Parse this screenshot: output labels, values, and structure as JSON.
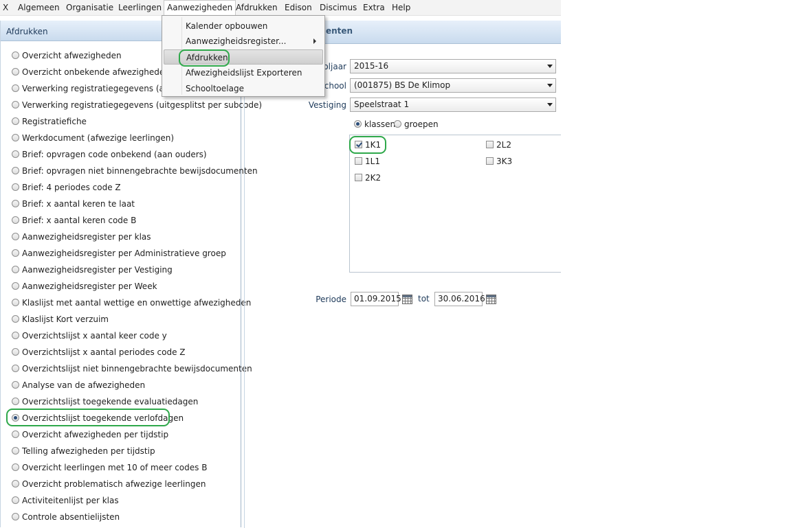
{
  "menubar": {
    "items": [
      "X",
      "Algemeen",
      "Organisatie",
      "Leerlingen",
      "Aanwezigheden",
      "Afdrukken",
      "Edison",
      "Discimus",
      "Extra",
      "Help"
    ]
  },
  "dropdown": {
    "items": [
      {
        "label": "Kalender opbouwen"
      },
      {
        "label": "Aanwezigheidsregister..."
      },
      {
        "label": "Afdrukken"
      },
      {
        "label": "Afwezigheidslijst Exporteren"
      },
      {
        "label": "Schooltoelage"
      }
    ]
  },
  "left_panel": {
    "title": "Afdrukken",
    "options": [
      "Overzicht afwezigheden",
      "Overzicht onbekende afwezigheden",
      "Verwerking registratiegegevens (alle codes)",
      "Verwerking registratiegegevens (uitgesplitst per subcode)",
      "Registratiefiche",
      "Werkdocument (afwezige leerlingen)",
      "Brief: opvragen code onbekend (aan ouders)",
      "Brief: opvragen niet binnengebrachte bewijsdocumenten",
      "Brief: 4 periodes code Z",
      "Brief: x aantal keren te laat",
      "Brief: x aantal keren code B",
      "Aanwezigheidsregister per klas",
      "Aanwezigheidsregister per Administratieve groep",
      "Aanwezigheidsregister per Vestiging",
      "Aanwezigheidsregister per Week",
      "Klaslijst met aantal wettige en onwettige afwezigheden",
      "Klaslijst Kort verzuim",
      "Overzichtslijst x aantal keer code y",
      "Overzichtslijst x aantal periodes code Z",
      "Overzichtslijst niet binnengebrachte bewijsdocumenten",
      "Analyse van de afwezigheden",
      "Overzichtslijst toegekende evaluatiedagen",
      "Overzichtslijst toegekende verlofdagen",
      "Overzicht afwezigheden per tijdstip",
      "Telling afwezigheden per tijdstip",
      "Overzicht leerlingen met 10 of meer codes B",
      "Overzicht problematisch afwezige leerlingen",
      "Activiteitenlijst per klas",
      "Controle absentielijsten"
    ],
    "selected": "Overzichtslijst toegekende verlofdagen"
  },
  "right_panel": {
    "header": "enten",
    "schooljaar_label": "oljaar",
    "schooljaar_value": "2015-16",
    "school_label": "chool",
    "school_value": "(001875) BS De Klimop",
    "vestiging_label": "Vestiging",
    "vestiging_value": "Speelstraat 1",
    "group_by": {
      "option1": "klassen",
      "option2": "groepen",
      "selected": "klassen"
    },
    "classes": [
      {
        "name": "1K1",
        "checked": true
      },
      {
        "name": "1L1",
        "checked": false
      },
      {
        "name": "2K2",
        "checked": false
      },
      {
        "name": "2L2",
        "checked": false
      },
      {
        "name": "3K3",
        "checked": false
      }
    ],
    "periode_label": "Periode",
    "periode_from": "01.09.2015",
    "tot_label": "tot",
    "periode_to": "30.06.2016"
  },
  "colors": {
    "highlight": "#2ea84a",
    "header_gradient": "#c9dbee"
  }
}
